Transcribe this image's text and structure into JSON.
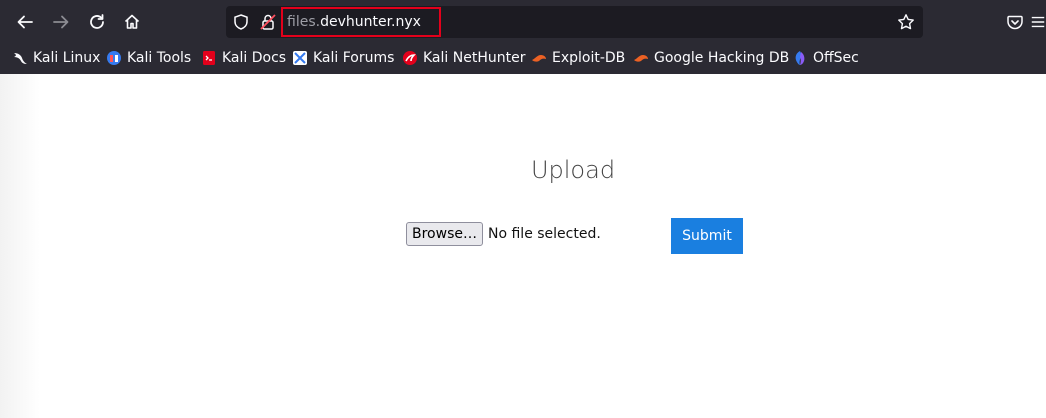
{
  "browser": {
    "url_subdomain": "files.",
    "url_domain": "devhunter.nyx",
    "bookmarks": [
      {
        "label": "Kali Linux",
        "icon": "kali-dragon-icon"
      },
      {
        "label": "Kali Tools",
        "icon": "kali-tools-icon"
      },
      {
        "label": "Kali Docs",
        "icon": "kali-docs-icon"
      },
      {
        "label": "Kali Forums",
        "icon": "kali-forums-icon"
      },
      {
        "label": "Kali NetHunter",
        "icon": "kali-nethunter-icon"
      },
      {
        "label": "Exploit-DB",
        "icon": "exploit-db-icon"
      },
      {
        "label": "Google Hacking DB",
        "icon": "google-hacking-db-icon"
      },
      {
        "label": "OffSec",
        "icon": "offsec-icon"
      }
    ],
    "colors": {
      "toolbar": "#2b2a33",
      "urlbar": "#1c1b22",
      "highlight_box": "#e3001b"
    }
  },
  "page": {
    "title": "Upload",
    "browse_label": "Browse…",
    "file_status": "No file selected.",
    "submit_label": "Submit",
    "colors": {
      "submit": "#1a7fe0"
    }
  }
}
